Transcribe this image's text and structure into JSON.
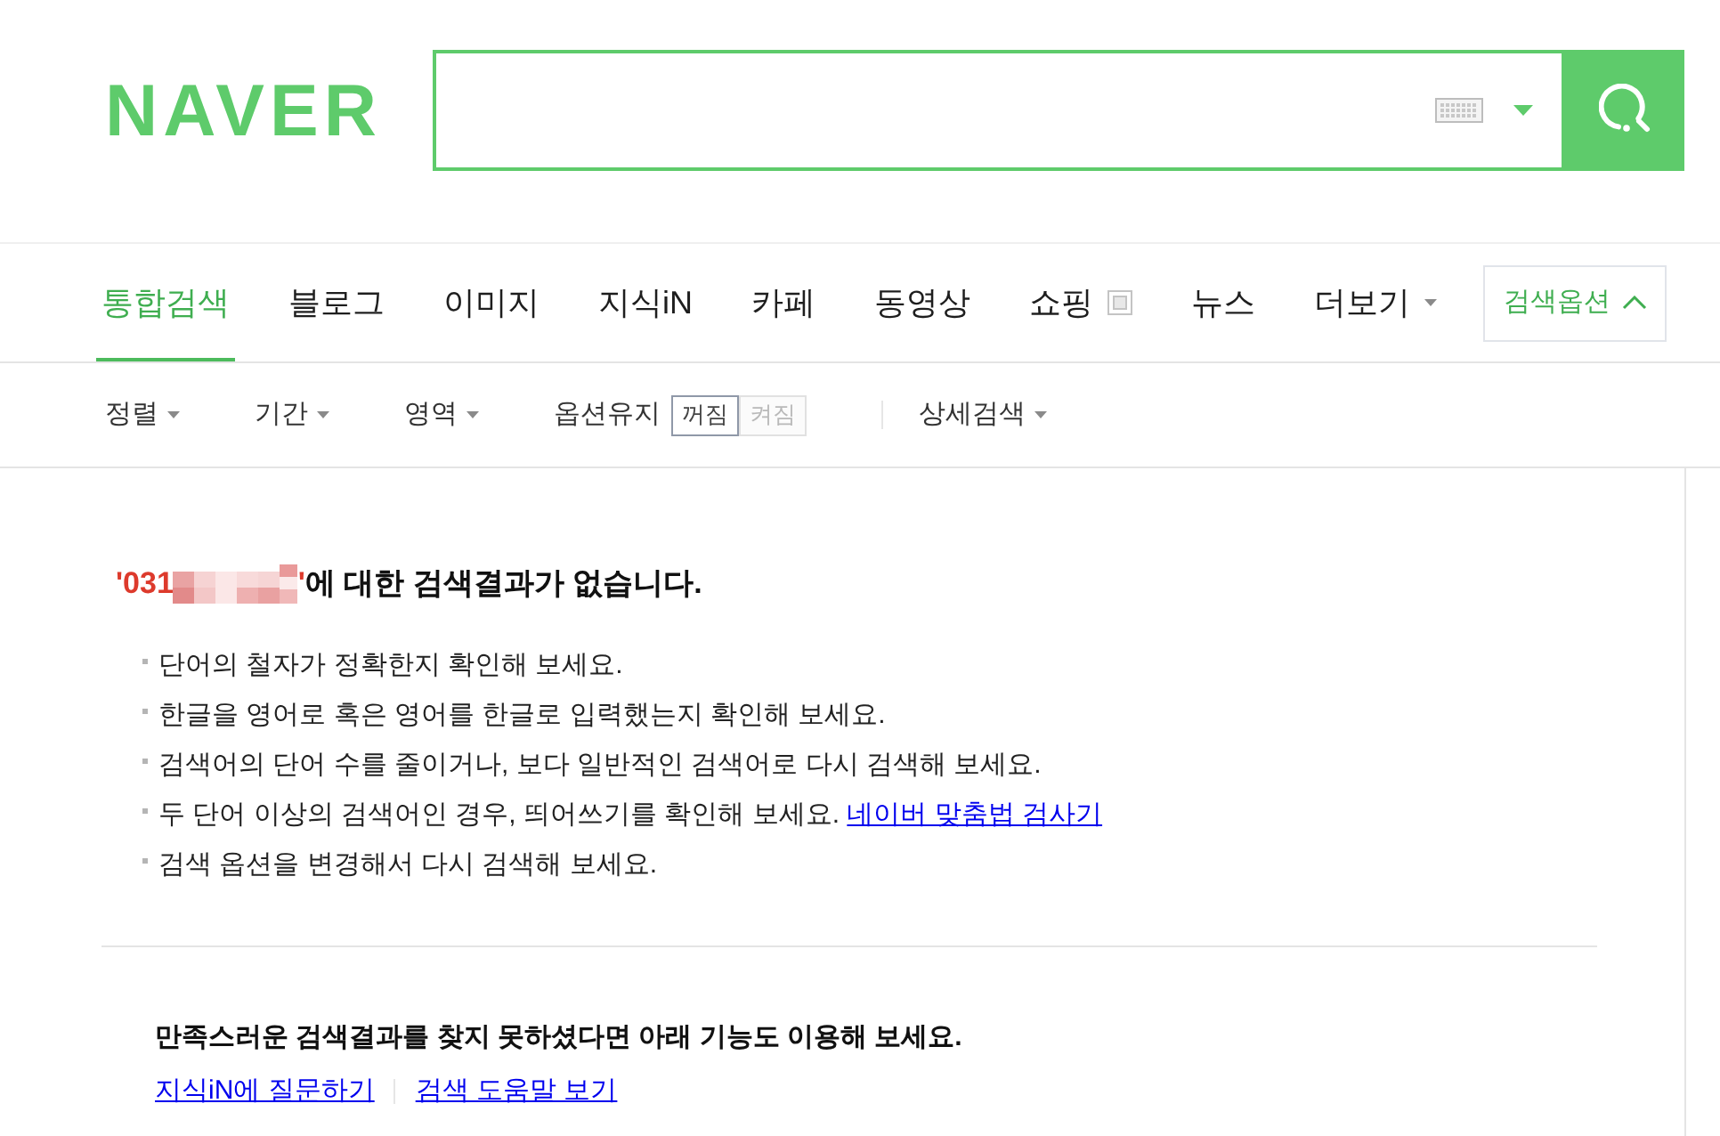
{
  "logo": "NAVER",
  "tabs": [
    {
      "label": "통합검색",
      "selected": true,
      "kind": "plain"
    },
    {
      "label": "블로그",
      "selected": false,
      "kind": "plain"
    },
    {
      "label": "이미지",
      "selected": false,
      "kind": "plain"
    },
    {
      "label": "지식iN",
      "selected": false,
      "kind": "plain"
    },
    {
      "label": "카페",
      "selected": false,
      "kind": "plain"
    },
    {
      "label": "동영상",
      "selected": false,
      "kind": "plain"
    },
    {
      "label": "쇼핑",
      "selected": false,
      "kind": "window"
    },
    {
      "label": "뉴스",
      "selected": false,
      "kind": "plain"
    },
    {
      "label": "더보기",
      "selected": false,
      "kind": "dropdown"
    }
  ],
  "search_options": {
    "label": "검색옵션",
    "expanded": true
  },
  "filters": [
    {
      "kind": "dropdown",
      "label": "정렬",
      "separated": false
    },
    {
      "kind": "dropdown",
      "label": "기간",
      "separated": false
    },
    {
      "kind": "dropdown",
      "label": "영역",
      "separated": false
    },
    {
      "kind": "toggle",
      "label": "옵션유지",
      "separated": false,
      "choices": [
        {
          "label": "꺼짐",
          "selected": true
        },
        {
          "label": "켜짐",
          "selected": false
        }
      ]
    },
    {
      "kind": "dropdown",
      "label": "상세검색",
      "separated": true
    }
  ],
  "no_result": {
    "query_prefix": "'031",
    "query_suffix": "'",
    "message": "에 대한 검색결과가 없습니다.",
    "tips": [
      {
        "text": "단어의 철자가 정확한지 확인해 보세요."
      },
      {
        "text": "한글을 영어로 혹은 영어를 한글로 입력했는지 확인해 보세요."
      },
      {
        "text": "검색어의 단어 수를 줄이거나, 보다 일반적인 검색어로 다시 검색해 보세요."
      },
      {
        "text": "두 단어 이상의 검색어인 경우, 띄어쓰기를 확인해 보세요.",
        "link": "네이버 맞춤법 검사기"
      },
      {
        "text": "검색 옵션을 변경해서 다시 검색해 보세요."
      }
    ]
  },
  "more_help": {
    "heading": "만족스러운 검색결과를 찾지 못하셨다면 아래 기능도 이용해 보세요.",
    "links": [
      "지식iN에 질문하기",
      "검색 도움말 보기"
    ]
  }
}
